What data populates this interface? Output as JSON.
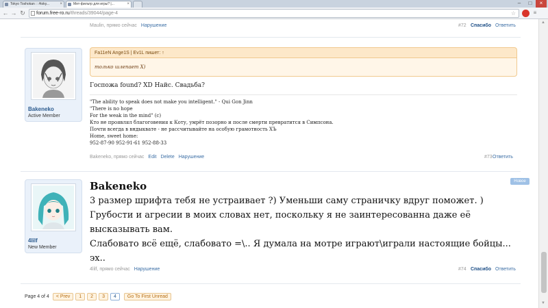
{
  "browser": {
    "tabs": [
      {
        "title": "Tokyo Toshokan :: #toky..."
      },
      {
        "title": "Мет-фильтр для игры? |..."
      }
    ],
    "url_host": "forum.free-ro.ru",
    "url_path": "/threads/39044/page-4"
  },
  "prev_post": {
    "meta_author": "Maulin, прямо сейчас",
    "report_label": "Нарушение",
    "number": "#72",
    "like_label": "Спасибо",
    "reply_label": "Ответить"
  },
  "post73": {
    "username": "Bakeneko",
    "user_title": "Active Member",
    "quote_header": "Fa11eN Ange1S | Ev1L пишет: ↑",
    "quote_text": "только шлепает X)",
    "message": "Госпожа found? XD Найс. Свадьба?",
    "signature": [
      "\"The ability to speak does not make you intelligent.\" - Qui Gon Jinn",
      "\"There is no hope",
      "For the weak in the mind\" (c)",
      "Кто не проявлял благоговения к Коту, умрёт позорно и после смерти превратится в Симпсона.",
      "Почти всегда в вндыквате - не рассчитывайте на особую грамотность ХЪ",
      "Home, sweet home:",
      "952-87-90 952-91-61 952-88-33"
    ],
    "meta_author": "Bakeneko, прямо сейчас",
    "edit_label": "Edit",
    "delete_label": "Delete",
    "report_label": "Нарушение",
    "number": "#73",
    "reply_label": "Ответить"
  },
  "post74": {
    "username": "4lilf",
    "user_title": "New Member",
    "new_badge": "Новое",
    "quoted_author": "Bakeneko",
    "lines": [
      "3 размер шрифта тебя не устраивает ?) Уменьши саму страничку вдруг поможет. )",
      "Грубости и агресии в моих словах нет, поскольку я не заинтересованна даже её",
      "высказывать вам.",
      "Слабовато всё ещё, слабовато =\\.. Я думала на мотре играют\\играли настоящие бойцы...",
      "эх.."
    ],
    "meta_author": "4lilf, прямо сейчас",
    "report_label": "Нарушение",
    "number": "#74",
    "like_label": "Спасибо",
    "reply_label": "Ответить"
  },
  "pagination": {
    "label": "Page 4 of 4",
    "prev_label": "< Prev",
    "pages": [
      "1",
      "2",
      "3",
      "4"
    ],
    "current": "4",
    "first_unread_label": "Go To First Unread"
  },
  "colors": {
    "link": "#3b6ea5",
    "quote_bg": "#fde8c9",
    "user_panel_bg": "#eaf1fa"
  }
}
